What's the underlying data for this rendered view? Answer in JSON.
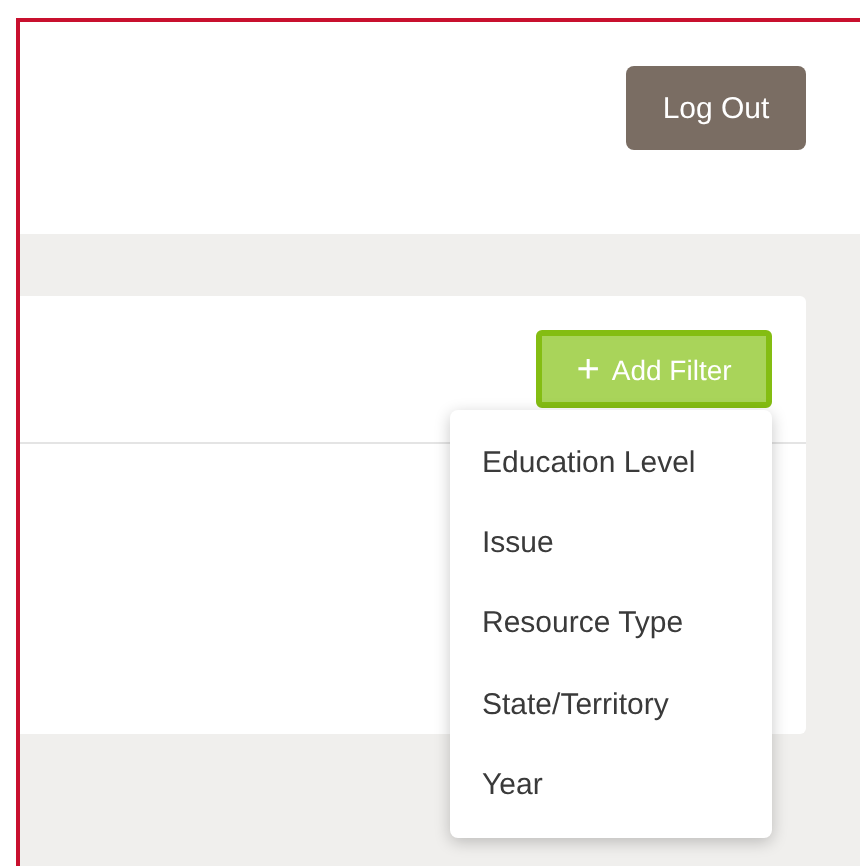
{
  "header": {
    "logout_button": "Log Out"
  },
  "filter_bar": {
    "add_filter_button": {
      "icon": "+",
      "label": "Add Filter"
    }
  },
  "filter_menu": {
    "items": [
      {
        "label": "Education Level"
      },
      {
        "label": "Issue"
      },
      {
        "label": "Resource Type"
      },
      {
        "label": "State/Territory"
      },
      {
        "label": "Year"
      }
    ]
  }
}
